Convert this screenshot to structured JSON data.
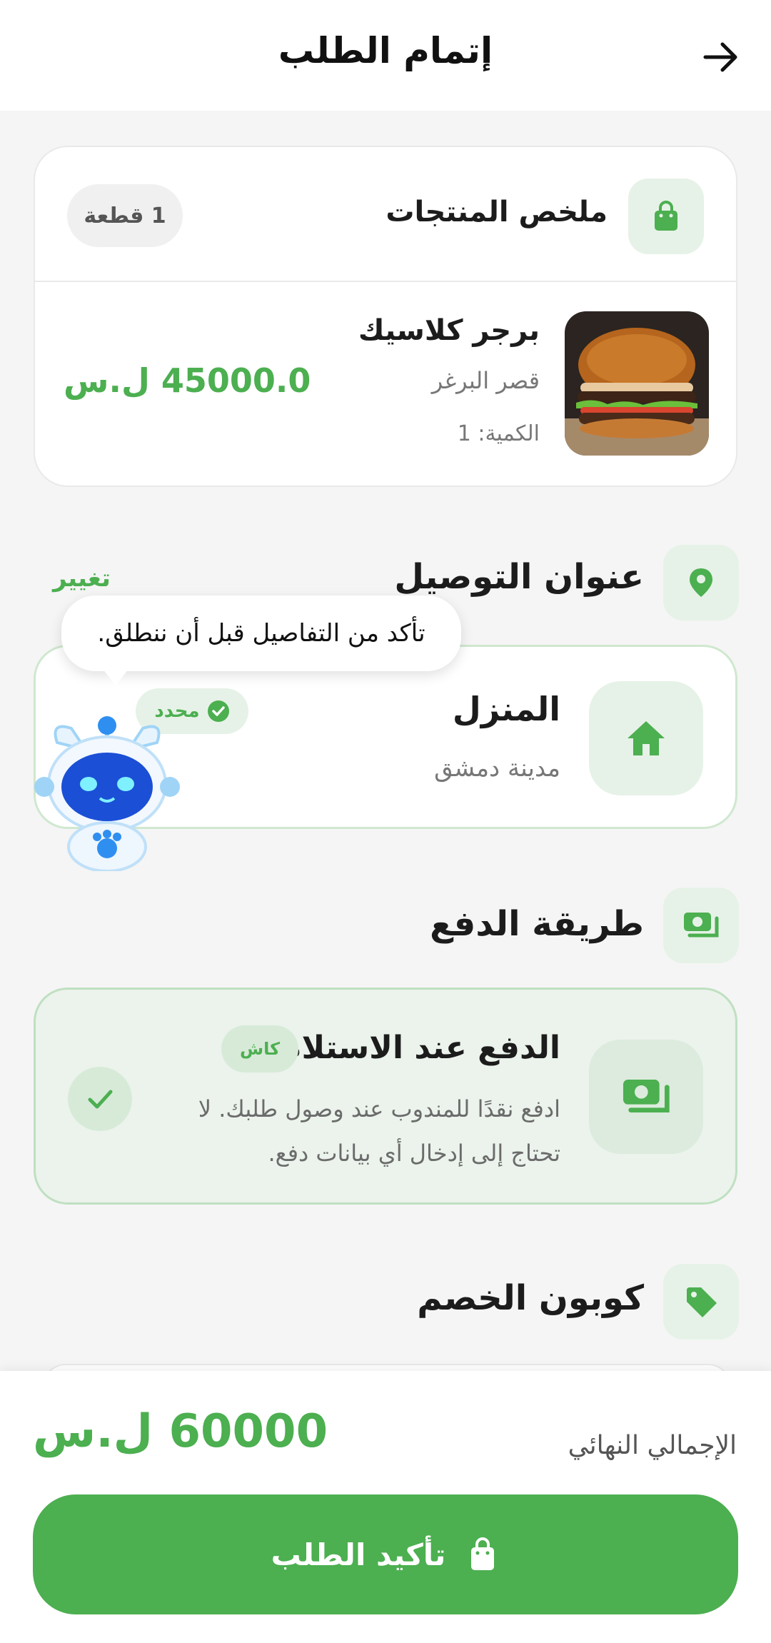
{
  "header": {
    "title": "إتمام الطلب",
    "back_icon": "arrow-right-icon"
  },
  "summary": {
    "title": "ملخص المنتجات",
    "icon": "shopping-bag-icon",
    "count_badge": "1 قطعة",
    "product": {
      "name": "برجر كلاسيك",
      "restaurant": "قصر البرغر",
      "quantity_label": "الكمية: 1",
      "price": "45000.0 ل.س",
      "image": "burger-image"
    }
  },
  "address": {
    "section_title": "عنوان التوصيل",
    "icon": "location-pin-icon",
    "change_label": "تغيير",
    "name": "المنزل",
    "city": "مدينة دمشق",
    "selected_label": "محدد",
    "home_icon": "home-icon"
  },
  "tooltip": {
    "text": "تأكد من التفاصيل قبل أن ننطلق."
  },
  "payment": {
    "section_title": "طريقة الدفع",
    "icon": "cash-icon",
    "method_name": "الدفع عند الاستلام",
    "badge": "كاش",
    "description": "ادفع نقدًا للمندوب عند وصول طلبك. لا تحتاج إلى إدخال أي بيانات دفع."
  },
  "coupon": {
    "section_title": "كوبون الخصم",
    "icon": "tag-icon"
  },
  "footer": {
    "total_label": "الإجمالي النهائي",
    "total_value": "60000 ل.س",
    "confirm_label": "تأكيد الطلب"
  },
  "colors": {
    "accent": "#4caf50",
    "accent_light": "#e6f2e7",
    "background": "#f5f5f5"
  }
}
